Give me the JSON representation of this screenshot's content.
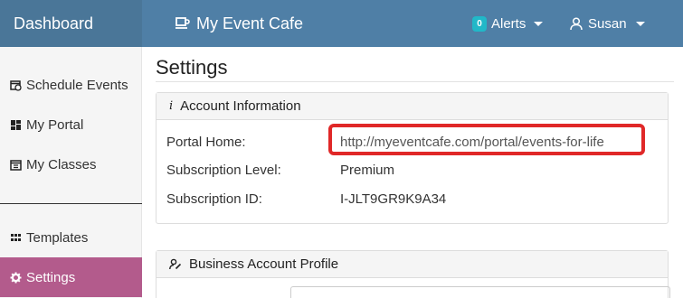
{
  "brand": "Dashboard",
  "app_title": "My Event Cafe",
  "alerts": {
    "count": "0",
    "label": "Alerts"
  },
  "user": {
    "name": "Susan"
  },
  "sidebar": {
    "items": [
      {
        "label": "Schedule Events",
        "icon": "calendar-clock-icon"
      },
      {
        "label": "My Portal",
        "icon": "dashboard-tiles-icon"
      },
      {
        "label": "My Classes",
        "icon": "calendar-list-icon"
      },
      {
        "label": "Templates",
        "icon": "grid-icon"
      },
      {
        "label": "Settings",
        "icon": "gear-icon",
        "active": true
      }
    ],
    "active_color": "#b35b8c"
  },
  "page": {
    "title": "Settings"
  },
  "account_panel": {
    "title": "Account Information",
    "icon": "info-icon",
    "rows": [
      {
        "label": "Portal Home:",
        "value": "http://myeventcafe.com/portal/events-for-life"
      },
      {
        "label": "Subscription Level:",
        "value": "Premium"
      },
      {
        "label": "Subscription ID:",
        "value": "I-JLT9GR9K9A34"
      }
    ],
    "highlight_color": "#e02828"
  },
  "business_panel": {
    "title": "Business Account Profile",
    "icon": "user-edit-icon"
  },
  "colors": {
    "topbar": "#4f7fa6",
    "brand_bg": "#4a7698",
    "badge": "#21b8c8"
  }
}
